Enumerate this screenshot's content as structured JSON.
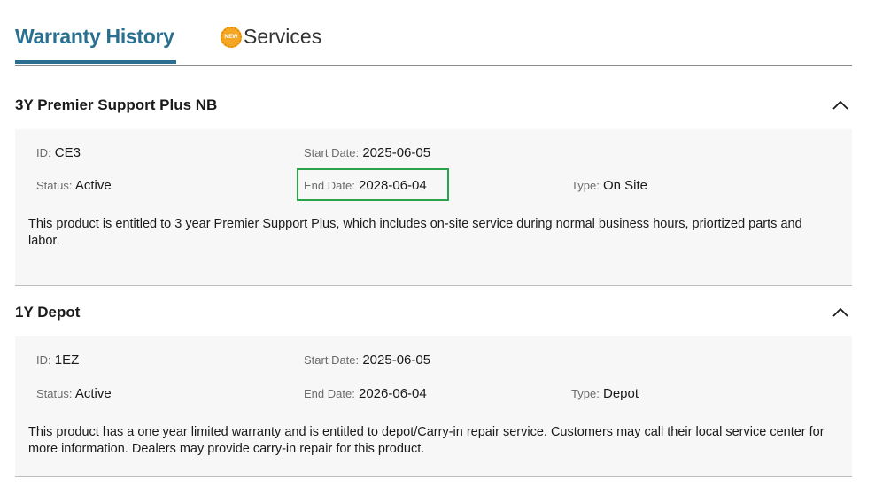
{
  "tabs": {
    "warranty_history": "Warranty History",
    "services": "Services",
    "new_badge": "NEW"
  },
  "colors": {
    "accent": "#2a6f8f",
    "highlight": "#2aa34a",
    "badge": "#f5a623"
  },
  "warranties": [
    {
      "title": "3Y Premier Support Plus NB",
      "id_label": "ID",
      "id_value": "CE3",
      "start_label": "Start Date",
      "start_value": "2025-06-05",
      "status_label": "Status",
      "status_value": "Active",
      "end_label": "End Date",
      "end_value": "2028-06-04",
      "type_label": "Type",
      "type_value": "On Site",
      "description": "This product is entitled to 3 year Premier Support Plus, which includes on-site service during normal business hours, priortized parts and labor."
    },
    {
      "title": "1Y Depot",
      "id_label": "ID",
      "id_value": "1EZ",
      "start_label": "Start Date",
      "start_value": "2025-06-05",
      "status_label": "Status",
      "status_value": "Active",
      "end_label": "End Date",
      "end_value": "2026-06-04",
      "type_label": "Type",
      "type_value": "Depot",
      "description": "This product has a one year limited warranty and is entitled to depot/Carry-in repair service. Customers may call their local service center for more information. Dealers may provide carry-in repair for this product."
    }
  ]
}
